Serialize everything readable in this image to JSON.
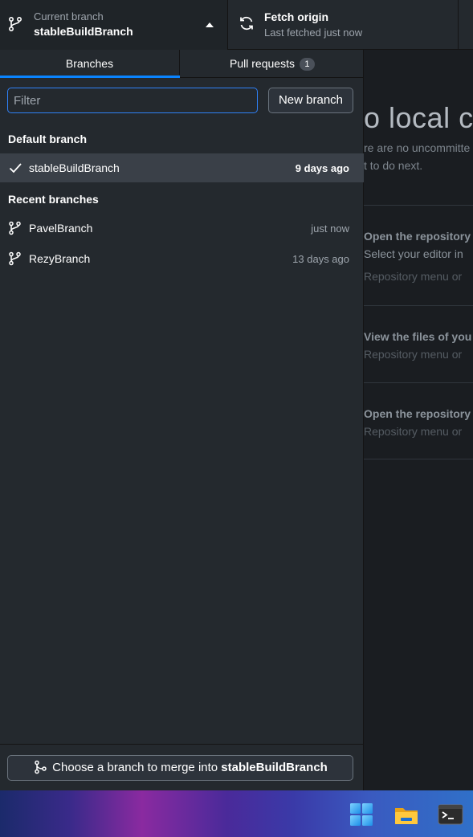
{
  "toolbar": {
    "branch_caption": "Current branch",
    "branch_name": "stableBuildBranch",
    "fetch_title": "Fetch origin",
    "fetch_status": "Last fetched just now"
  },
  "tabs": {
    "branches": "Branches",
    "pull_requests": "Pull requests",
    "pull_requests_count": "1"
  },
  "filter": {
    "placeholder": "Filter",
    "value": ""
  },
  "new_branch_label": "New branch",
  "default_group": {
    "title": "Default branch",
    "items": [
      {
        "name": "stableBuildBranch",
        "time": "9 days ago",
        "selected": true
      }
    ]
  },
  "recent_group": {
    "title": "Recent branches",
    "items": [
      {
        "name": "PavelBranch",
        "time": "just now"
      },
      {
        "name": "RezyBranch",
        "time": "13 days ago"
      }
    ]
  },
  "merge": {
    "prefix": "Choose a branch to merge into ",
    "target": "stableBuildBranch"
  },
  "background": {
    "heading": "o local c",
    "line1": "re are no uncommitte",
    "line2": "t to do next.",
    "cards": [
      {
        "title": "Open the repository",
        "subtitle": "Select your editor in",
        "meta": "Repository menu or"
      },
      {
        "title": "View the files of you",
        "meta": "Repository menu or"
      },
      {
        "title": "Open the repository",
        "meta": "Repository menu or"
      }
    ]
  },
  "taskbar": {
    "icons": [
      "windows-start-icon",
      "file-explorer-icon",
      "terminal-icon"
    ]
  },
  "colors": {
    "accent": "#0a84ff",
    "panel": "#24292e",
    "selected_row": "#3a4048"
  }
}
